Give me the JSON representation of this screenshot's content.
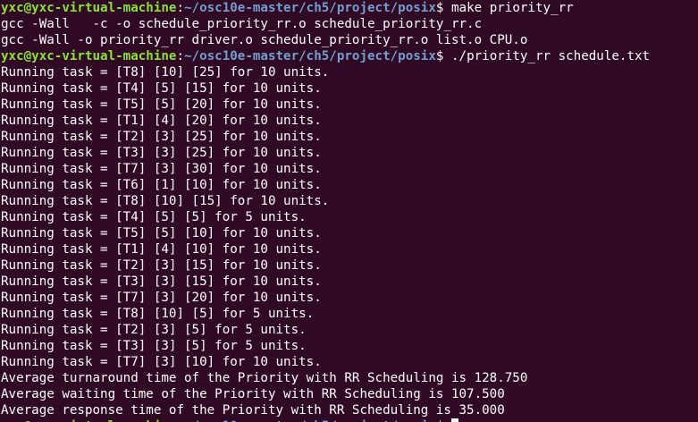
{
  "colors": {
    "background": "#300a24",
    "text": "#ffffff",
    "prompt_user": "#8ae234",
    "prompt_path": "#729fcf"
  },
  "prompt": {
    "user_host": "yxc@yxc-virtual-machine",
    "separator": ":",
    "path": "~/osc10e-master/ch5/project/posix",
    "dollar": "$ "
  },
  "commands": {
    "make": "make priority_rr",
    "run": "./priority_rr schedule.txt"
  },
  "build_output": [
    "gcc -Wall   -c -o schedule_priority_rr.o schedule_priority_rr.c",
    "gcc -Wall -o priority_rr driver.o schedule_priority_rr.o list.o CPU.o"
  ],
  "run_output": [
    "Running task = [T8] [10] [25] for 10 units.",
    "Running task = [T4] [5] [15] for 10 units.",
    "Running task = [T5] [5] [20] for 10 units.",
    "Running task = [T1] [4] [20] for 10 units.",
    "Running task = [T2] [3] [25] for 10 units.",
    "Running task = [T3] [3] [25] for 10 units.",
    "Running task = [T7] [3] [30] for 10 units.",
    "Running task = [T6] [1] [10] for 10 units.",
    "Running task = [T8] [10] [15] for 10 units.",
    "Running task = [T4] [5] [5] for 5 units.",
    "Running task = [T5] [5] [10] for 10 units.",
    "Running task = [T1] [4] [10] for 10 units.",
    "Running task = [T2] [3] [15] for 10 units.",
    "Running task = [T3] [3] [15] for 10 units.",
    "Running task = [T7] [3] [20] for 10 units.",
    "Running task = [T8] [10] [5] for 5 units.",
    "Running task = [T2] [3] [5] for 5 units.",
    "Running task = [T3] [3] [5] for 5 units.",
    "Running task = [T7] [3] [10] for 10 units."
  ],
  "summary": {
    "turnaround": "Average turnaround time of the Priority with RR Scheduling is 128.750",
    "waiting": "Average waiting time of the Priority with RR Scheduling is 107.500",
    "response": "Average response time of the Priority with RR Scheduling is 35.000"
  }
}
